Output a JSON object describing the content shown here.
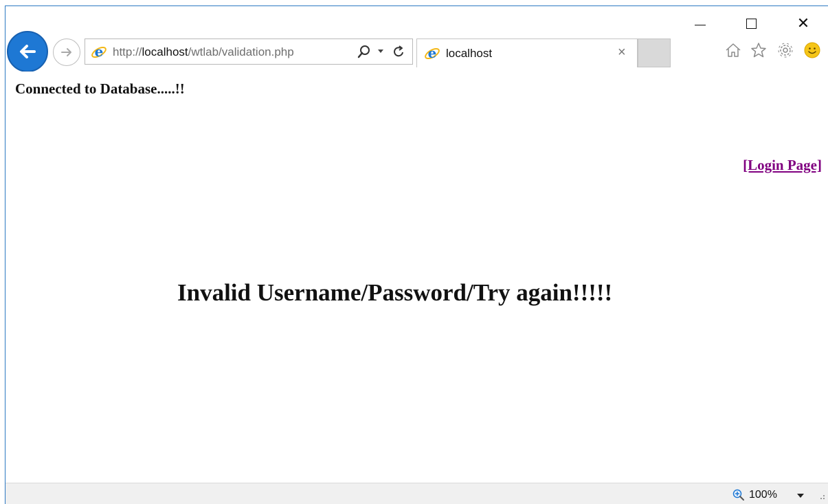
{
  "browser": {
    "address": {
      "url_prefix": "http://",
      "url_host": "localhost",
      "url_path": "/wtlab/validation.php"
    },
    "tab": {
      "title": "localhost",
      "close_glyph": "×"
    },
    "caption": {
      "close_glyph": "✕"
    },
    "icons": [
      "back-arrow-icon",
      "forward-arrow-icon",
      "ie-logo-icon",
      "search-icon",
      "dropdown-icon",
      "refresh-icon",
      "home-icon",
      "star-icon",
      "gear-icon",
      "smiley-icon",
      "zoom-icon"
    ],
    "accent_color": "#1e78d4"
  },
  "page": {
    "status_message": "Connected to Database.....!!",
    "login_link": "[Login Page]",
    "error_message": "Invalid Username/Password/Try again!!!!!",
    "link_color": "#800080"
  },
  "status_bar": {
    "zoom": "100%"
  }
}
